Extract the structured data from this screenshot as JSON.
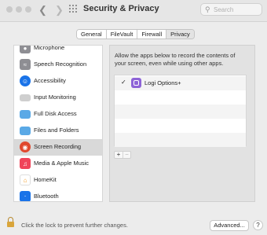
{
  "titlebar": {
    "title": "Security & Privacy",
    "back_icon": "chevron-left-icon",
    "forward_icon": "chevron-right-icon",
    "grid_icon": "grid-icon"
  },
  "search": {
    "placeholder": "Search",
    "value": ""
  },
  "tabs": [
    {
      "label": "General",
      "active": false
    },
    {
      "label": "FileVault",
      "active": false
    },
    {
      "label": "Firewall",
      "active": false
    },
    {
      "label": "Privacy",
      "active": true
    }
  ],
  "sidebar": {
    "items": [
      {
        "label": "Microphone",
        "icon": "microphone-icon",
        "color": "#8e8e93",
        "selected": false
      },
      {
        "label": "Speech Recognition",
        "icon": "waveform-icon",
        "color": "#8e8e93",
        "selected": false
      },
      {
        "label": "Accessibility",
        "icon": "accessibility-icon",
        "color": "#1a73e8",
        "selected": false
      },
      {
        "label": "Input Monitoring",
        "icon": "keyboard-icon",
        "color": "#cfcfcf",
        "selected": false
      },
      {
        "label": "Full Disk Access",
        "icon": "folder-icon",
        "color": "#5aa9e6",
        "selected": false
      },
      {
        "label": "Files and Folders",
        "icon": "folder-icon",
        "color": "#5aa9e6",
        "selected": false
      },
      {
        "label": "Screen Recording",
        "icon": "screen-recording-icon",
        "color": "#e0482e",
        "selected": true
      },
      {
        "label": "Media & Apple Music",
        "icon": "music-icon",
        "color": "#f0445a",
        "selected": false
      },
      {
        "label": "HomeKit",
        "icon": "home-icon",
        "color": "#f59b23",
        "selected": false
      },
      {
        "label": "Bluetooth",
        "icon": "bluetooth-icon",
        "color": "#1a73e8",
        "selected": false
      }
    ]
  },
  "pane": {
    "description": "Allow the apps below to record the contents of your screen, even while using other apps.",
    "apps": [
      {
        "name": "Logi Options+",
        "checked": true,
        "check_mark": "✓",
        "icon": "logi-options-icon"
      }
    ],
    "add_label": "+",
    "remove_label": "−"
  },
  "footer": {
    "lock_text": "Click the lock to prevent further changes.",
    "advanced_label": "Advanced...",
    "help_label": "?",
    "lock_icon": "lock-icon"
  }
}
